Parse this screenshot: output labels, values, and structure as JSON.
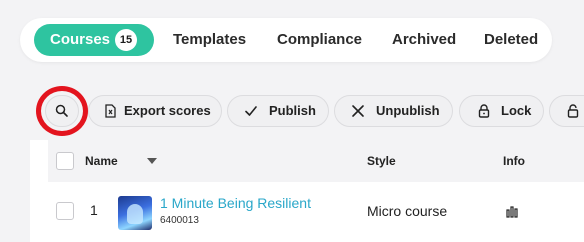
{
  "tabs": [
    {
      "label": "Courses",
      "count": "15",
      "active": true
    },
    {
      "label": "Templates"
    },
    {
      "label": "Compliance"
    },
    {
      "label": "Archived"
    },
    {
      "label": "Deleted"
    }
  ],
  "toolbar": {
    "search_icon": "search-icon",
    "export_label": "Export scores",
    "publish_label": "Publish",
    "unpublish_label": "Unpublish",
    "lock_label": "Lock"
  },
  "table": {
    "columns": {
      "name": "Name",
      "style": "Style",
      "info": "Info"
    },
    "rows": [
      {
        "num": "1",
        "title": "1 Minute Being Resilient",
        "id": "6400013",
        "style": "Micro course",
        "info_icon": "bar-chart-icon"
      }
    ]
  },
  "colors": {
    "accent": "#2ec4a0",
    "link": "#2aa7c9",
    "highlight_ring": "#e3141e"
  }
}
